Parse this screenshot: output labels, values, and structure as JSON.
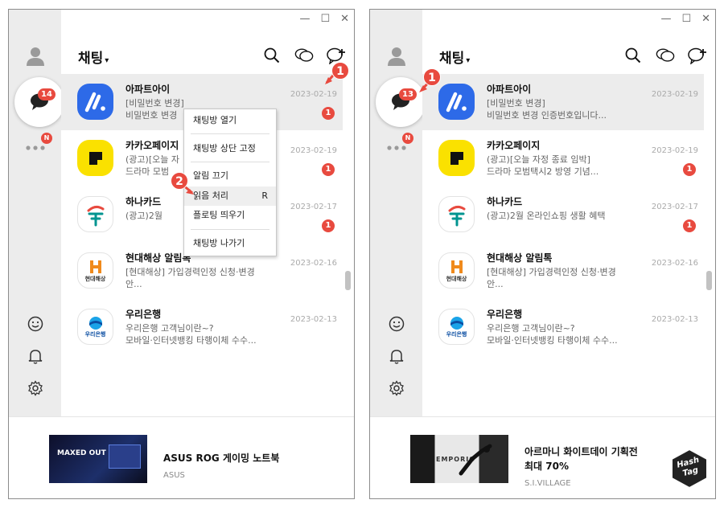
{
  "window_controls": {
    "minimize": "—",
    "maximize": "☐",
    "close": "✕"
  },
  "header": {
    "title": "채팅",
    "caret": "▾"
  },
  "left": {
    "chat_badge": "14",
    "more_badge": "N",
    "chats": [
      {
        "name": "아파트아이",
        "msg": "[비밀번호 변경]\n비밀번호 변경",
        "date": "2023-02-19",
        "unread": "1"
      },
      {
        "name": "카카오페이지",
        "msg": "(광고)[오늘 자\n드라마 모범",
        "date": "2023-02-19",
        "unread": "1"
      },
      {
        "name": "하나카드",
        "msg": "(광고)2월 ",
        "date": "2023-02-17",
        "unread": "1"
      },
      {
        "name": "현대해상 알림톡",
        "msg": "[현대해상] 가입경력인정 신청·변경\n안...",
        "date": "2023-02-16",
        "unread": ""
      },
      {
        "name": "우리은행",
        "msg": "우리은행 고객님이란~?\n모바일·인터넷뱅킹 타행이체 수수...",
        "date": "2023-02-13",
        "unread": ""
      }
    ],
    "menu": {
      "items": [
        "채팅방 열기",
        "채팅방 상단 고정",
        "알림 끄기",
        "읽음 처리",
        "플로팅 띄우기",
        "채팅방 나가기"
      ],
      "shortcut": "R"
    },
    "ad": {
      "title": "ASUS ROG 게이밍 노트북",
      "sub": "ASUS",
      "img_text": "MAXED OUT"
    },
    "markers": [
      "1",
      "2"
    ]
  },
  "right": {
    "chat_badge": "13",
    "more_badge": "N",
    "chats": [
      {
        "name": "아파트아이",
        "msg": "[비밀번호 변경]\n비밀번호 변경 인증번호입니다...",
        "date": "2023-02-19",
        "unread": ""
      },
      {
        "name": "카카오페이지",
        "msg": "(광고)[오늘 자정 종료 임박]\n드라마 모범택시2 방영 기념...",
        "date": "2023-02-19",
        "unread": "1"
      },
      {
        "name": "하나카드",
        "msg": "(광고)2월 온라인쇼핑 생활 혜택",
        "date": "2023-02-17",
        "unread": "1"
      },
      {
        "name": "현대해상 알림톡",
        "msg": "[현대해상] 가입경력인정 신청·변경\n안...",
        "date": "2023-02-16",
        "unread": ""
      },
      {
        "name": "우리은행",
        "msg": "우리은행 고객님이란~?\n모바일·인터넷뱅킹 타행이체 수수...",
        "date": "2023-02-13",
        "unread": ""
      }
    ],
    "ad": {
      "title": "아르마니 화이트데이 기획전\n최대 70%",
      "sub": "S.I.VILLAGE",
      "img_text": "EMPORIO"
    },
    "markers": [
      "1"
    ]
  },
  "avatar_text": {
    "hyundai": "현대해상",
    "woori": "우리은행"
  },
  "hashtag": {
    "line1": "Hash",
    "line2": "Tag"
  },
  "colors": {
    "accent_red": "#e84a3f",
    "sidebar": "#ececec",
    "kakao_yellow": "#fae100"
  }
}
